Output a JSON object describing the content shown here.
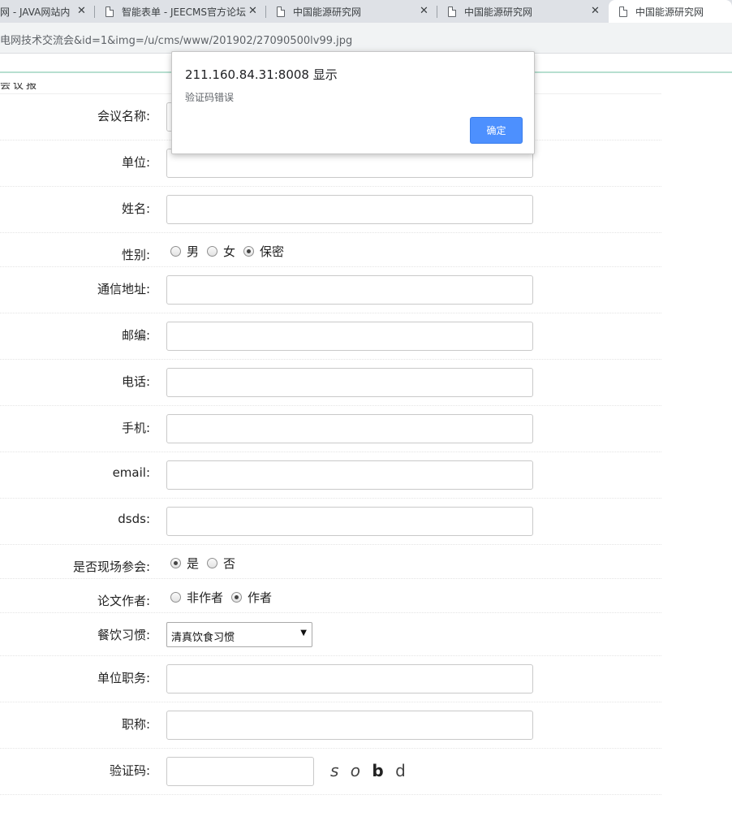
{
  "browser": {
    "tabs": [
      {
        "title": "网 - JAVA网站内",
        "active": false
      },
      {
        "title": "智能表单 - JEECMS官方论坛",
        "active": false
      },
      {
        "title": "中国能源研究网",
        "active": false
      },
      {
        "title": "中国能源研究网",
        "active": false
      },
      {
        "title": "中国能源研究网",
        "active": true
      }
    ],
    "close_glyph": "✕",
    "url": "电网技术交流会&id=1&img=/u/cms/www/201902/27090500lv99.jpg"
  },
  "page": {
    "clipped_heading": "会议报名"
  },
  "form": {
    "meeting_name_label": "会议名称:",
    "unit_label": "单位:",
    "name_label": "姓名:",
    "gender": {
      "label": "性别:",
      "options": [
        "男",
        "女",
        "保密"
      ],
      "selected": "保密"
    },
    "address_label": "通信地址:",
    "postcode_label": "邮编:",
    "phone_label": "电话:",
    "mobile_label": "手机:",
    "email_label": "email:",
    "dsds_label": "dsds:",
    "attend": {
      "label": "是否现场参会:",
      "options": [
        "是",
        "否"
      ],
      "selected": "是"
    },
    "author": {
      "label": "论文作者:",
      "options": [
        "非作者",
        "作者"
      ],
      "selected": "作者"
    },
    "diet": {
      "label": "餐饮习惯:",
      "selected": "清真饮食习惯",
      "arrow": "▼"
    },
    "position_label": "单位职务:",
    "title_label": "职称:",
    "captcha": {
      "label": "验证码:",
      "chars": [
        "s",
        "o",
        "b",
        "d"
      ]
    }
  },
  "dialog": {
    "title": "211.160.84.31:8008 显示",
    "message": "验证码错误",
    "ok_label": "确定",
    "button_color": "#4d90fe"
  }
}
